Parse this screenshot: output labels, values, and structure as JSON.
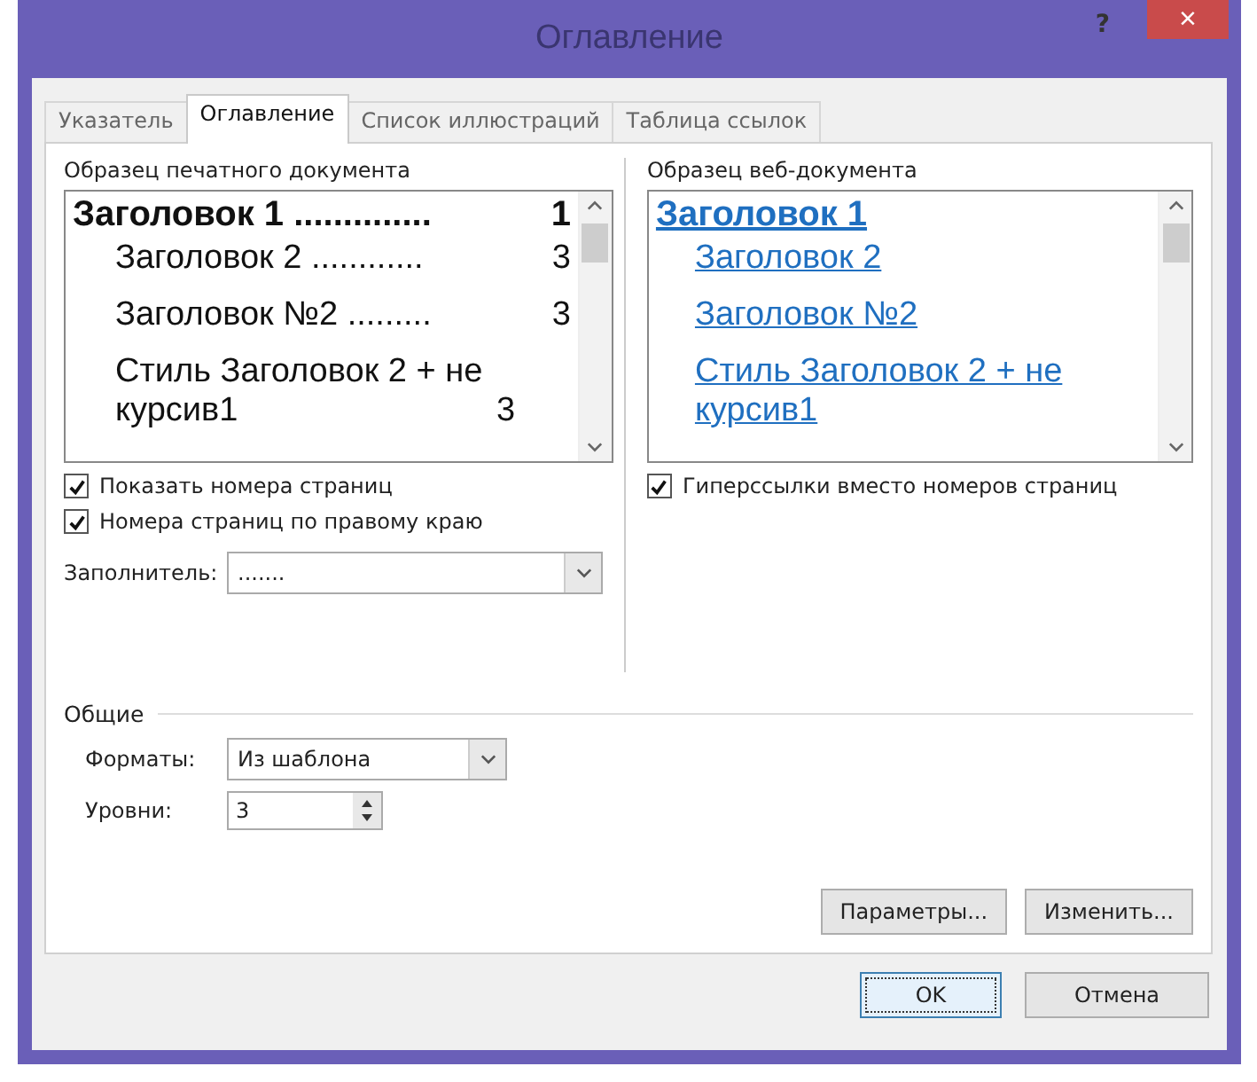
{
  "window": {
    "title": "Оглавление",
    "help": "?",
    "close": "×"
  },
  "tabs": [
    {
      "label": "Указатель",
      "selected": false
    },
    {
      "label": "Оглавление",
      "selected": true
    },
    {
      "label": "Список иллюстраций",
      "selected": false
    },
    {
      "label": "Таблица ссылок",
      "selected": false
    }
  ],
  "print_preview": {
    "label": "Образец печатного документа",
    "entries": [
      {
        "label": "Заголовок 1",
        "leader": "..............",
        "page": "1",
        "children": [
          {
            "label": "Заголовок 2",
            "leader": "............",
            "page": "3"
          },
          {
            "label": "Заголовок №2",
            "leader": ".........",
            "page": "3"
          },
          {
            "label": "Стиль Заголовок 2 + не курсив1",
            "page": "3"
          }
        ]
      }
    ]
  },
  "web_preview": {
    "label": "Образец веб-документа",
    "entries": [
      {
        "label": "Заголовок 1",
        "children": [
          {
            "label": "Заголовок 2"
          },
          {
            "label": "Заголовок №2"
          },
          {
            "label": "Стиль Заголовок 2 + не курсив1"
          }
        ]
      }
    ]
  },
  "print_options": [
    {
      "label": "Показать номера страниц",
      "checked": true
    },
    {
      "label": "Номера страниц по правому краю",
      "checked": true
    }
  ],
  "web_options": [
    {
      "label": "Гиперссылки вместо номеров страниц",
      "checked": true
    }
  ],
  "leader_field": {
    "label": "Заполнитель:",
    "value": "......."
  },
  "general": {
    "title": "Общие",
    "formats": {
      "label": "Форматы:",
      "value": "Из шаблона"
    },
    "levels": {
      "label": "Уровни:",
      "value": "3"
    }
  },
  "panel_buttons": [
    "Параметры...",
    "Изменить..."
  ],
  "dialog_buttons": [
    {
      "label": "OK",
      "default": true
    },
    {
      "label": "Отмена",
      "default": false
    }
  ]
}
